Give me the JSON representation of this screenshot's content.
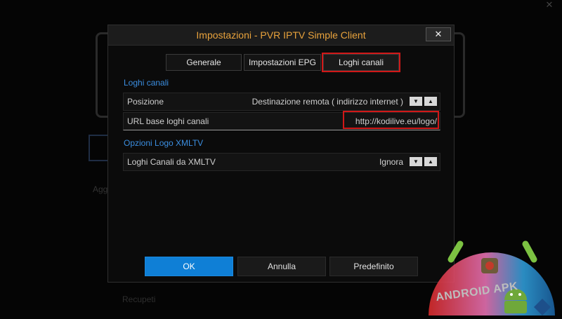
{
  "background": {
    "close_glyph": "✕",
    "left_text": "Agg",
    "bottom_text": "Recupeti"
  },
  "dialog": {
    "title": "Impostazioni - PVR IPTV Simple Client",
    "close_glyph": "✕",
    "tabs": [
      {
        "label": "Generale",
        "active": false
      },
      {
        "label": "Impostazioni EPG",
        "active": false
      },
      {
        "label": "Loghi canali",
        "active": true
      }
    ],
    "section_logos": {
      "title": "Loghi canali",
      "rows": [
        {
          "label": "Posizione",
          "value": "Destinazione remota ( indirizzo internet )"
        },
        {
          "label": "URL base loghi canali",
          "value": "http://kodilive.eu/logo/"
        }
      ]
    },
    "section_xmltv": {
      "title": "Opzioni Logo XMLTV",
      "rows": [
        {
          "label": "Loghi Canali da XMLTV",
          "value": "Ignora"
        }
      ]
    },
    "spinner": {
      "down_glyph": "▼",
      "up_glyph": "▲"
    },
    "buttons": {
      "ok": "OK",
      "cancel": "Annulla",
      "default": "Predefinito"
    }
  },
  "watermark": {
    "text": "ANDROID APK",
    "icon": "android-robot-icon"
  },
  "colors": {
    "title": "#e8a23c",
    "section_title": "#3b8ee0",
    "ok_button": "#0f7fd6",
    "highlight": "#d11818"
  }
}
